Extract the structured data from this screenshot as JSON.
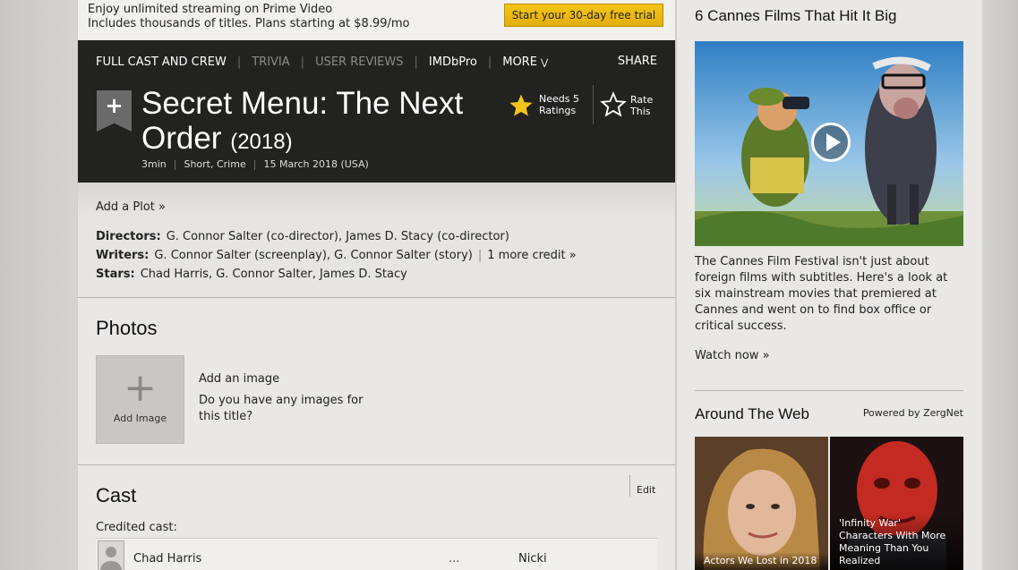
{
  "promo": {
    "line1": "Enjoy unlimited streaming on Prime Video",
    "line2": "Includes thousands of titles. Plans starting at $8.99/mo",
    "button": "Start your 30-day free trial"
  },
  "nav": {
    "full_cast": "FULL CAST AND CREW",
    "trivia": "TRIVIA",
    "user_reviews": "USER REVIEWS",
    "imdbpro": "IMDbPro",
    "more": "MORE",
    "share": "SHARE"
  },
  "title": {
    "name": "Secret Menu: The Next Order",
    "year": "(2018)",
    "runtime": "3min",
    "genres": "Short, Crime",
    "release": "15 March 2018 (USA)",
    "rating_needs_line1": "Needs 5",
    "rating_needs_line2": "Ratings",
    "rate_line1": "Rate",
    "rate_line2": "This",
    "star_color": "#f5c518"
  },
  "plot": {
    "add_plot": "Add a Plot »",
    "directors_label": "Directors:",
    "directors": "G. Connor Salter (co-director), James D. Stacy (co-director)",
    "writers_label": "Writers:",
    "writers": "G. Connor Salter (screenplay), G. Connor Salter (story)",
    "more_credit": "1 more credit »",
    "stars_label": "Stars:",
    "stars": "Chad Harris, G. Connor Salter, James D. Stacy"
  },
  "photos": {
    "heading": "Photos",
    "add_image_label": "Add Image",
    "add_image_title": "Add an image",
    "add_image_text": "Do you have any images for this title?"
  },
  "cast": {
    "heading": "Cast",
    "edit": "Edit",
    "credited": "Credited cast:",
    "rows": [
      {
        "name": "Chad Harris",
        "dots": "...",
        "character": "Nicki"
      }
    ]
  },
  "sidebar": {
    "feature_title": "6 Cannes Films That Hit It Big",
    "feature_text": "The Cannes Film Festival isn't just about foreign films with subtitles. Here's a look at six mainstream movies that premiered at Cannes and went on to find box office or critical success.",
    "watch_now": "Watch now »",
    "around_title": "Around The Web",
    "powered_by": "Powered by ZergNet",
    "cards": [
      {
        "caption": "Actors We Lost in 2018"
      },
      {
        "caption": "'Infinity War' Characters With More Meaning Than You Realized"
      }
    ]
  }
}
